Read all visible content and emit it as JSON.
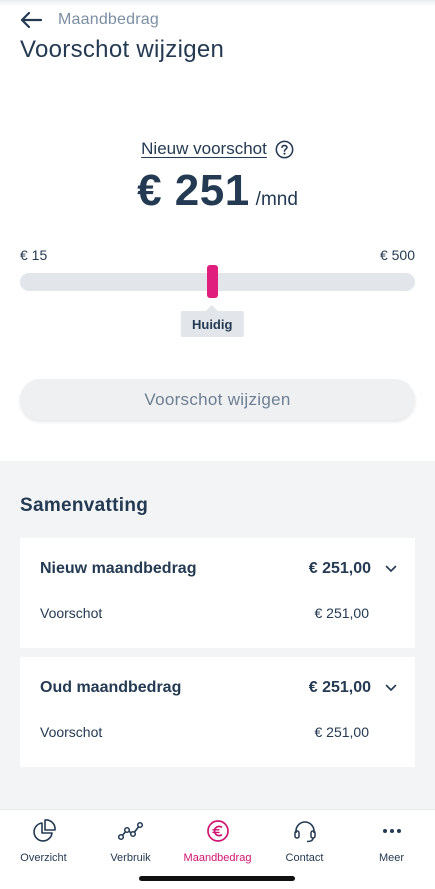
{
  "header": {
    "breadcrumb": "Maandbedrag",
    "title": "Voorschot wijzigen"
  },
  "advance": {
    "label": "Nieuw voorschot",
    "amount": "€ 251",
    "unit": "/mnd"
  },
  "slider": {
    "min_label": "€ 15",
    "max_label": "€ 500",
    "min": 15,
    "max": 500,
    "value": 251,
    "current_value": 251,
    "current_label": "Huidig"
  },
  "submit_label": "Voorschot wijzigen",
  "summary": {
    "title": "Samenvatting",
    "cards": [
      {
        "title": "Nieuw maandbedrag",
        "amount": "€ 251,00",
        "row_label": "Voorschot",
        "row_value": "€ 251,00"
      },
      {
        "title": "Oud maandbedrag",
        "amount": "€ 251,00",
        "row_label": "Voorschot",
        "row_value": "€ 251,00"
      }
    ]
  },
  "nav": {
    "items": [
      {
        "label": "Overzicht",
        "icon": "pie-chart-icon"
      },
      {
        "label": "Verbruik",
        "icon": "usage-graph-icon"
      },
      {
        "label": "Maandbedrag",
        "icon": "euro-icon",
        "active": true
      },
      {
        "label": "Contact",
        "icon": "headset-icon"
      },
      {
        "label": "Meer",
        "icon": "more-dots-icon"
      }
    ]
  },
  "colors": {
    "primary_text": "#243a52",
    "accent": "#e01e7e",
    "muted": "#7b8ea3"
  }
}
